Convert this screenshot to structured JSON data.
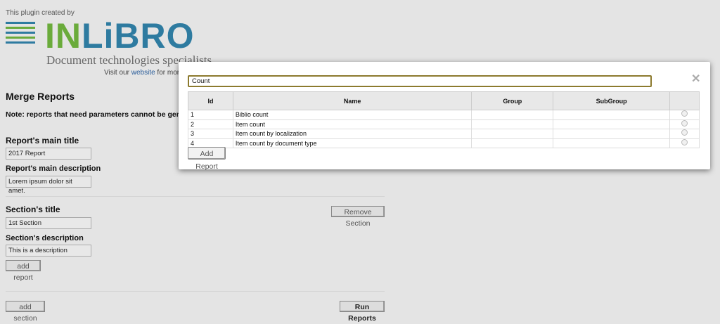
{
  "header": {
    "credit": "This plugin created by",
    "logo_text": "INLiBRO",
    "logo_part1": "IN",
    "logo_part2": "LiBRO",
    "tagline": "Document technologies specialists",
    "visit_prefix": "Visit our",
    "visit_link": "website",
    "visit_suffix": "for more",
    "colors": {
      "green": "#6aab3b",
      "blue": "#2e7ba0"
    }
  },
  "main": {
    "title": "Merge Reports",
    "note": "Note: reports that need parameters cannot be gene",
    "report_title_label": "Report's main title",
    "report_title_value": "2017 Report",
    "report_desc_label": "Report's main description",
    "report_desc_value": "Lorem ipsum dolor sit amet.",
    "section": {
      "title_label": "Section's title",
      "title_value": "1st Section",
      "desc_label": "Section's description",
      "desc_value": "This is a description",
      "remove_label": "Remove Section",
      "add_report_label": "add report"
    },
    "add_section_label": "add section",
    "run_label": "Run Reports"
  },
  "modal": {
    "search_value": "Count",
    "close_icon": "close-icon",
    "columns": [
      "Id",
      "Name",
      "Group",
      "SubGroup",
      ""
    ],
    "rows": [
      {
        "id": "1",
        "name": "Biblio count",
        "group": "",
        "subgroup": ""
      },
      {
        "id": "2",
        "name": "Item count",
        "group": "",
        "subgroup": ""
      },
      {
        "id": "3",
        "name": "Item count by localization",
        "group": "",
        "subgroup": ""
      },
      {
        "id": "4",
        "name": "Item count by document type",
        "group": "",
        "subgroup": ""
      }
    ],
    "add_label": "Add Report"
  }
}
